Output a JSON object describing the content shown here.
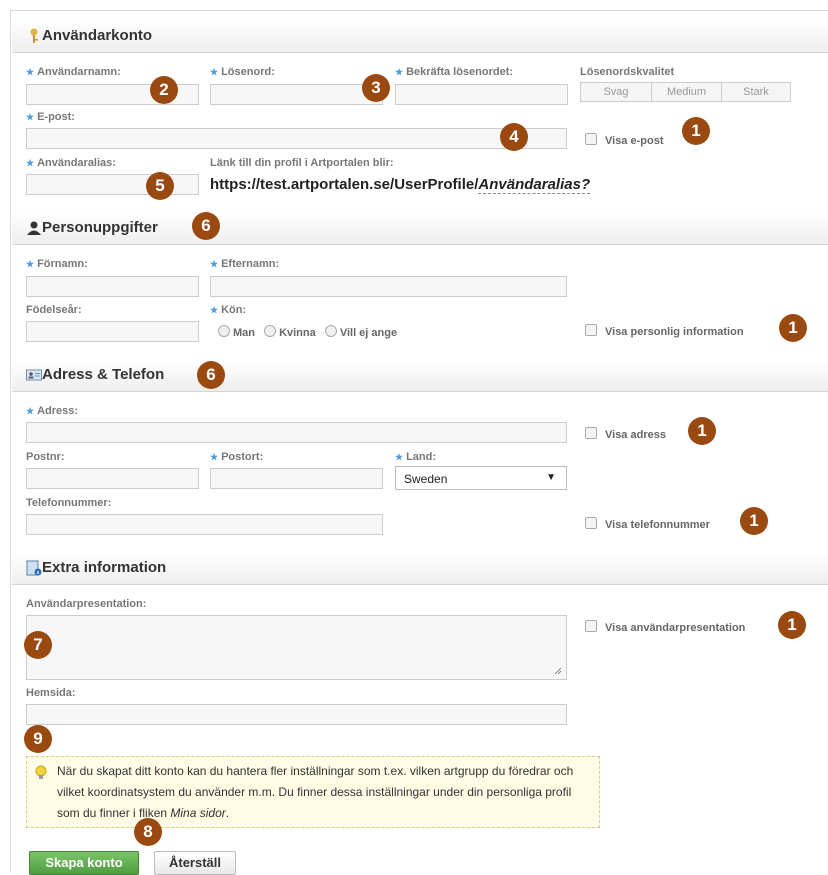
{
  "sections": {
    "account": "Användarkonto",
    "personal": "Personuppgifter",
    "address": "Adress & Telefon",
    "extra": "Extra information"
  },
  "fields": {
    "username": "Användarnamn:",
    "password": "Lösenord:",
    "confirm_password": "Bekräfta lösenordet:",
    "password_quality": "Lösenordskvalitet",
    "email": "E-post:",
    "alias": "Användaralias:",
    "profile_link_label": "Länk till din profil i Artportalen blir:",
    "firstname": "Förnamn:",
    "lastname": "Efternamn:",
    "birthyear": "Födelseår:",
    "gender": "Kön:",
    "address": "Adress:",
    "postnr": "Postnr:",
    "postort": "Postort:",
    "country": "Land:",
    "phone": "Telefonnummer:",
    "presentation": "Användarpresentation:",
    "homepage": "Hemsida:"
  },
  "password_quality_options": [
    "Svag",
    "Medium",
    "Stark"
  ],
  "profile_url": {
    "base": "https://test.artportalen.se/UserProfile/",
    "alias": "Användaralias?"
  },
  "gender_options": [
    "Man",
    "Kvinna",
    "Vill ej ange"
  ],
  "country_value": "Sweden",
  "checkboxes": {
    "email": "Visa e-post",
    "personal": "Visa personlig information",
    "address": "Visa adress",
    "phone": "Visa telefonnummer",
    "presentation": "Visa användarpresentation"
  },
  "info": {
    "text": "När du skapat ditt konto kan du hantera fler inställningar som t.ex. vilken artgrupp du föredrar och vilket koordinatsystem du använder m.m. Du finner dessa inställningar under din personliga profil som du finner i fliken ",
    "link": "Mina sidor",
    "end": "."
  },
  "buttons": {
    "create": "Skapa konto",
    "reset": "Återställ"
  },
  "badges": {
    "b1": "1",
    "b2": "2",
    "b3": "3",
    "b4": "4",
    "b5": "5",
    "b6": "6",
    "b7": "7",
    "b8": "8",
    "b9": "9"
  },
  "colors": {
    "badge": "#9a4a11",
    "required_star": "#4a9de0",
    "create_button": "#5aa94a"
  }
}
